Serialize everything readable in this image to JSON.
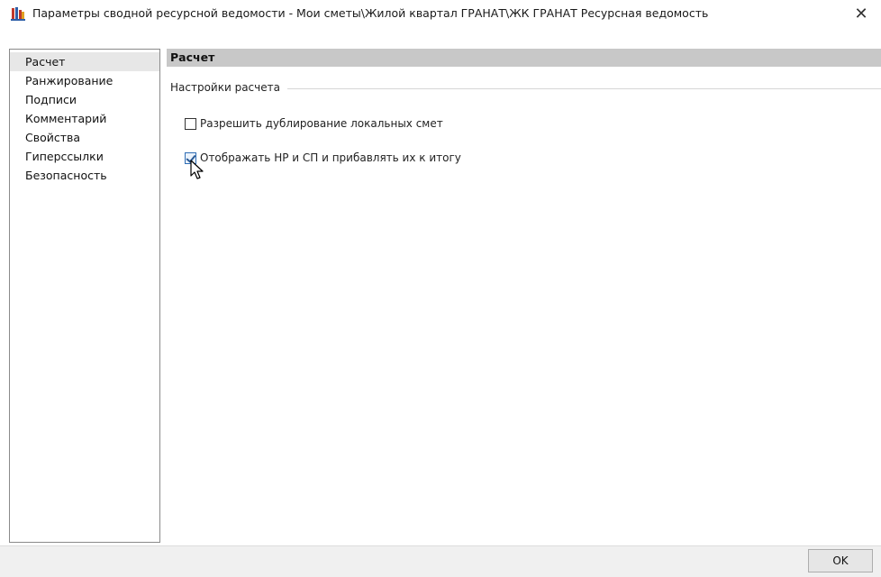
{
  "window": {
    "title": "Параметры сводной ресурсной ведомости - Мои сметы\\Жилой квартал ГРАНАТ\\ЖК ГРАНАТ Ресурсная ведомость",
    "close_label": "✕",
    "icon": "app-grid-icon"
  },
  "sidebar": {
    "items": [
      {
        "label": "Расчет",
        "active": true
      },
      {
        "label": "Ранжирование",
        "active": false
      },
      {
        "label": "Подписи",
        "active": false
      },
      {
        "label": "Комментарий",
        "active": false
      },
      {
        "label": "Свойства",
        "active": false
      },
      {
        "label": "Гиперссылки",
        "active": false
      },
      {
        "label": "Безопасность",
        "active": false
      }
    ]
  },
  "content": {
    "header": "Расчет",
    "group_label": "Настройки расчета",
    "options": [
      {
        "label": "Разрешить дублирование локальных смет",
        "checked": false
      },
      {
        "label": "Отображать НР и СП и прибавлять их к итогу",
        "checked": true
      }
    ]
  },
  "footer": {
    "ok_label": "OK"
  }
}
